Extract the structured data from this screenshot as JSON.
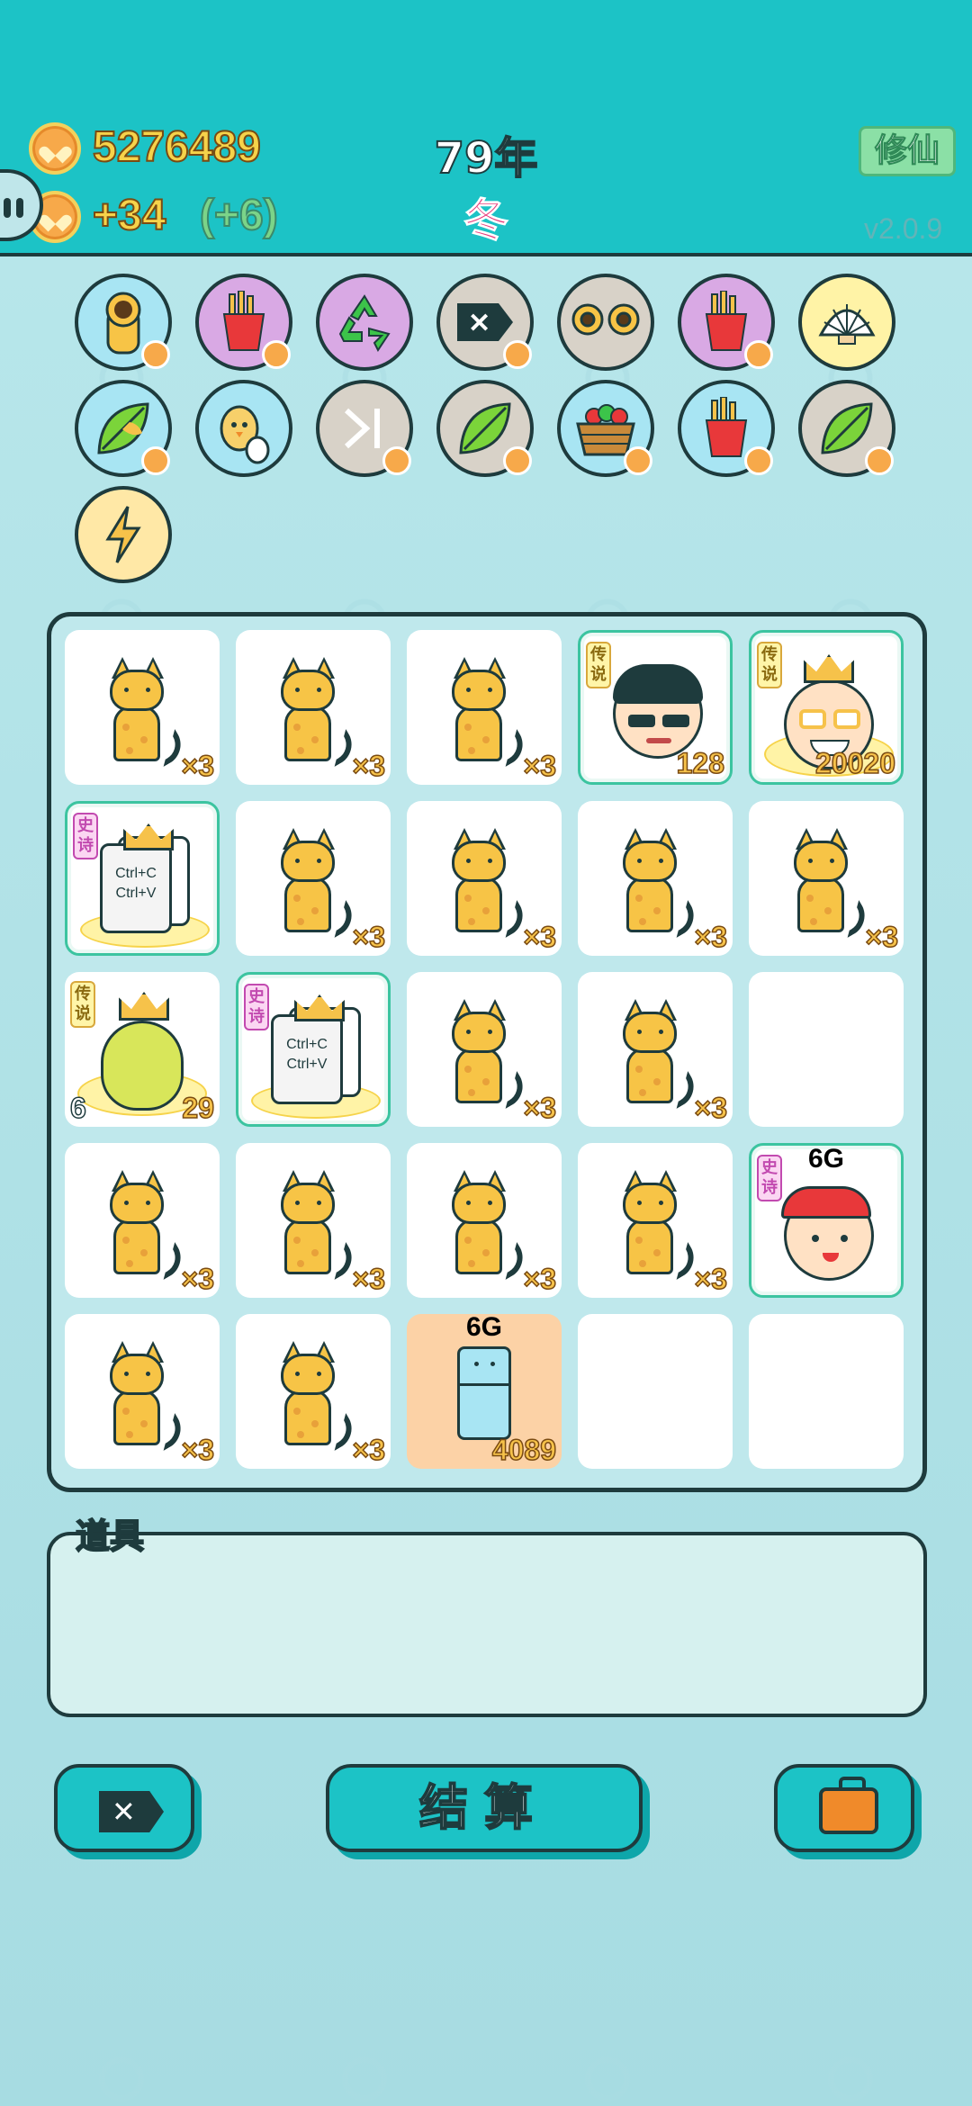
{
  "header": {
    "coins": "5276489",
    "income": "+34",
    "bonus": "(+6)",
    "year": "79年",
    "season": "冬",
    "mode_button": "修仙",
    "version": "v2.0.9"
  },
  "skills": [
    {
      "icon": "cat-icon"
    },
    {
      "icon": "fries-icon"
    },
    {
      "icon": "recycle-icon"
    },
    {
      "icon": "delete-tag-icon"
    },
    {
      "icon": "two-cats-icon"
    },
    {
      "icon": "fries-icon"
    },
    {
      "icon": "shell-icon"
    },
    {
      "icon": "leaf-icon"
    },
    {
      "icon": "chick-egg-icon"
    },
    {
      "icon": "skip-icon"
    },
    {
      "icon": "leaf-icon"
    },
    {
      "icon": "fruit-basket-icon"
    },
    {
      "icon": "fries-icon"
    },
    {
      "icon": "leaf-icon"
    },
    {
      "icon": "lightning-icon"
    }
  ],
  "board": {
    "tiles": [
      {
        "type": "cat",
        "count": "×3"
      },
      {
        "type": "cat",
        "count": "×3"
      },
      {
        "type": "cat",
        "count": "×3"
      },
      {
        "type": "man-sunglasses",
        "rarity": "传说",
        "count": "128"
      },
      {
        "type": "old-king",
        "rarity": "传说",
        "count": "20020"
      },
      {
        "type": "ctrl",
        "rarity": "史诗",
        "line1": "Ctrl+C",
        "line2": "Ctrl+V"
      },
      {
        "type": "cat",
        "count": "×3"
      },
      {
        "type": "cat",
        "count": "×3"
      },
      {
        "type": "cat",
        "count": "×3"
      },
      {
        "type": "cat",
        "count": "×3"
      },
      {
        "type": "pear",
        "rarity": "传说",
        "level": "6",
        "count": "29"
      },
      {
        "type": "ctrl",
        "rarity": "史诗",
        "line1": "Ctrl+C",
        "line2": "Ctrl+V"
      },
      {
        "type": "cat",
        "count": "×3"
      },
      {
        "type": "cat",
        "count": "×3"
      },
      {
        "type": "empty"
      },
      {
        "type": "cat",
        "count": "×3"
      },
      {
        "type": "cat",
        "count": "×3"
      },
      {
        "type": "cat",
        "count": "×3"
      },
      {
        "type": "cat",
        "count": "×3"
      },
      {
        "type": "boy-red-cap",
        "rarity": "史诗",
        "g": "6G"
      },
      {
        "type": "cat",
        "count": "×3"
      },
      {
        "type": "cat",
        "count": "×3"
      },
      {
        "type": "fridge",
        "g": "6G",
        "count": "4089"
      },
      {
        "type": "empty"
      },
      {
        "type": "empty"
      }
    ]
  },
  "props": {
    "label": "道具"
  },
  "buttons": {
    "remove": "delete-tag-icon",
    "settle": "结算",
    "bag": "briefcase-icon"
  }
}
